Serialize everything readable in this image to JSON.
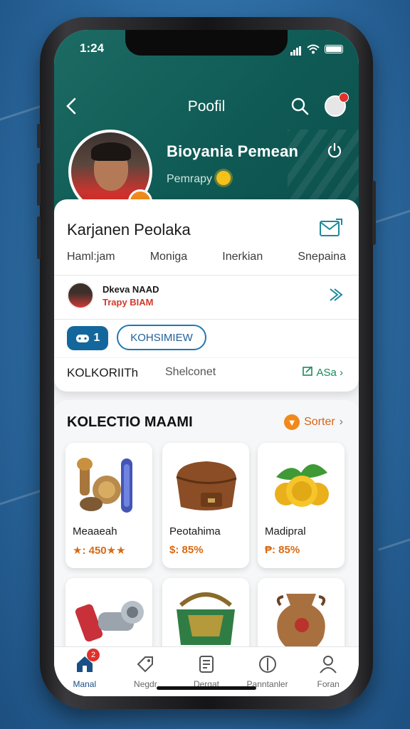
{
  "status": {
    "time": "1:24"
  },
  "header": {
    "title": "Poofil",
    "player_name": "Bioyania Pemean",
    "player_sub": "Pemrapy"
  },
  "card": {
    "title": "Karjanen Peolaka",
    "tabs": [
      "Haml:jam",
      "Moniga",
      "Inerkian",
      "Snepaina"
    ],
    "person": {
      "name": "Dkeva NAAD",
      "sub": "Trapy BIAM"
    },
    "button_primary": "1",
    "button_outline": "KOHSIMIEW",
    "footer_left": "KOLKORIITh",
    "footer_mid": "Shelconet",
    "footer_right": "ASa"
  },
  "collection": {
    "title": "KOLECTIO MAAMI",
    "sort_label": "Sorter",
    "items": [
      {
        "name": "Meaaeah",
        "price": "★: 450★★"
      },
      {
        "name": "Peotahima",
        "price": "$: 85%"
      },
      {
        "name": "Madipral",
        "price": "₱: 85%"
      },
      {
        "name": "",
        "price": ""
      },
      {
        "name": "",
        "price": ""
      },
      {
        "name": "",
        "price": ""
      }
    ]
  },
  "tabbar": {
    "items": [
      {
        "label": "Manal",
        "badge": "2"
      },
      {
        "label": "Negdr"
      },
      {
        "label": "Dergat"
      },
      {
        "label": "Panntanler"
      },
      {
        "label": "Foran"
      }
    ]
  },
  "colors": {
    "header_teal": "#0f5a55",
    "accent_blue": "#14679c",
    "accent_orange": "#f08a1c"
  }
}
